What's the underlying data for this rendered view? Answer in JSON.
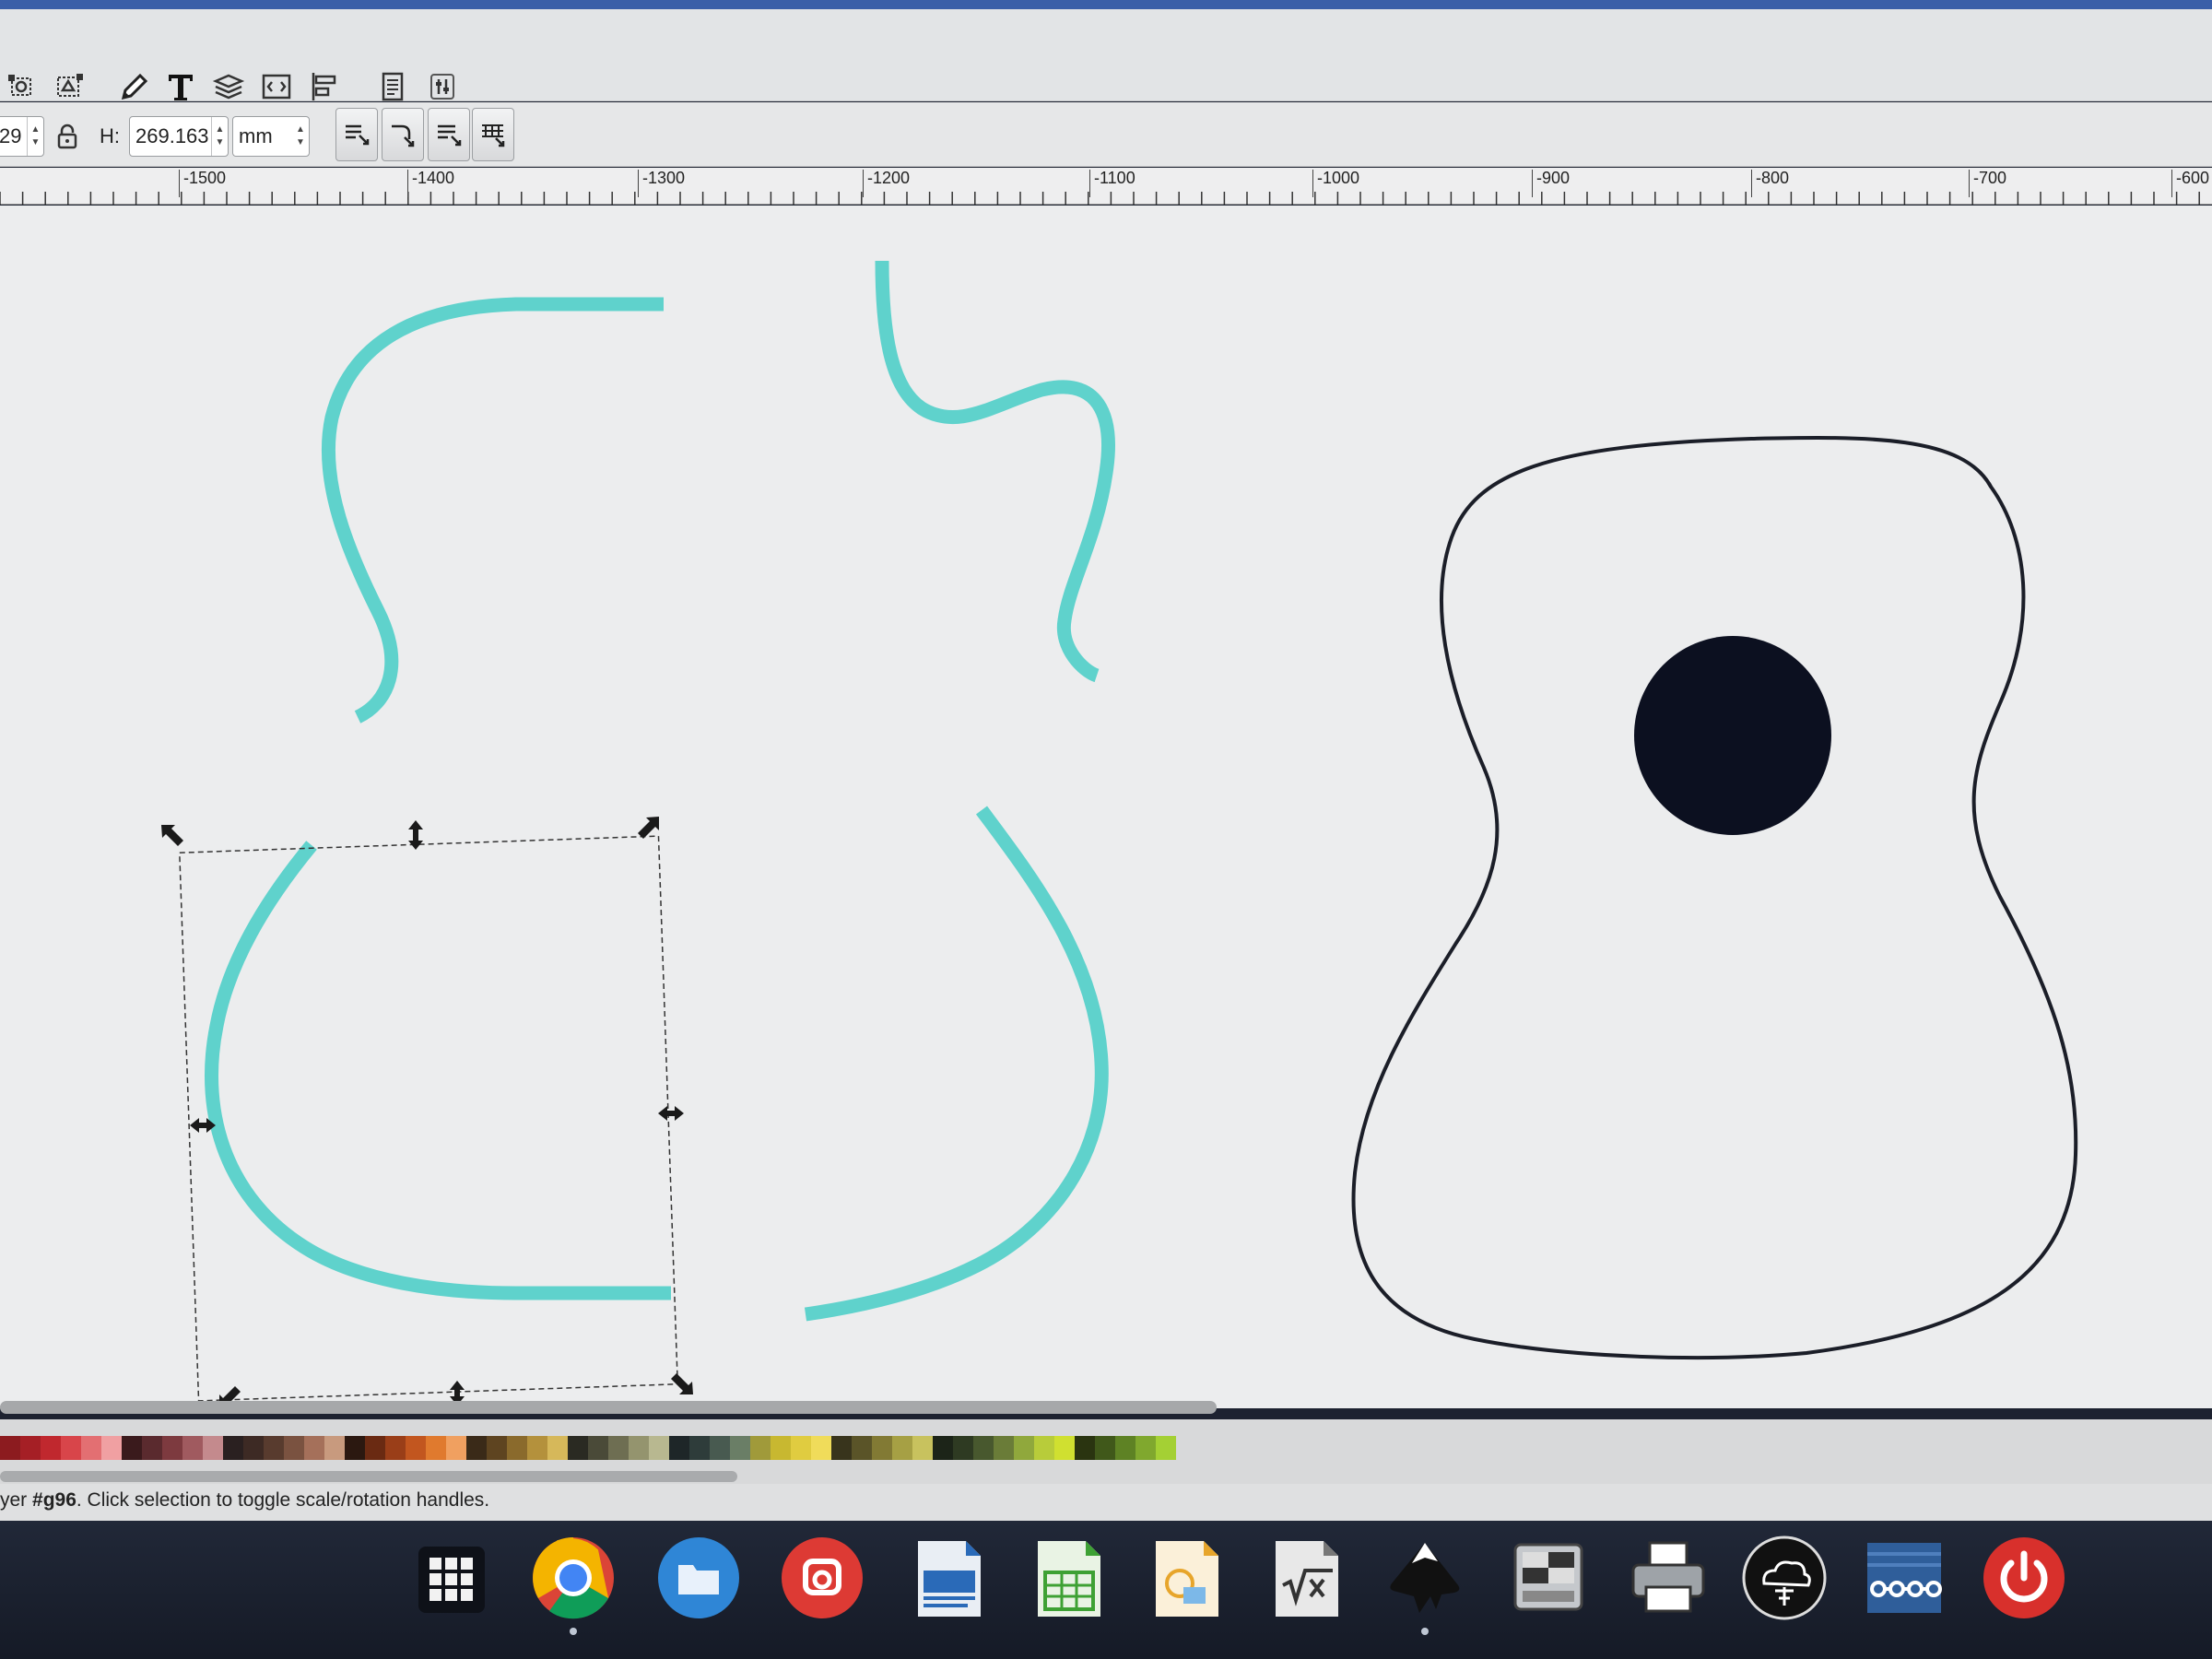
{
  "colors": {
    "accent_stroke": "#5fd2cc",
    "outline_stroke": "#1b1e28",
    "sound_hole": "#0c1020",
    "canvas": "#ecedee",
    "toolbar": "#e2e4e6"
  },
  "commands_bar": {
    "icons": [
      "node-select-icon",
      "transform-node-icon",
      "edit-document-icon",
      "text-tool-icon",
      "layers-icon",
      "xml-editor-icon",
      "align-distribute-icon",
      "document-properties-icon",
      "preferences-icon"
    ]
  },
  "tool_controls": {
    "w_value": "29",
    "lock_icon": "lock-icon",
    "h_label": "H:",
    "h_value": "269.163",
    "unit": "mm",
    "transform_toggles": [
      "scale-stroke-icon",
      "scale-corners-icon",
      "move-gradients-icon",
      "move-patterns-icon"
    ]
  },
  "ruler": {
    "labels": [
      "-1500",
      "-1400",
      "-1300",
      "-1200",
      "-1100",
      "-1000",
      "-900",
      "-800",
      "-700",
      "-600"
    ]
  },
  "canvas": {
    "selected_object": "g96",
    "shapes": [
      "cyan-upper-left-bout",
      "cyan-upper-right-bout",
      "cyan-lower-left-bout",
      "cyan-lower-right-bout",
      "guitar-body-outline",
      "sound-hole"
    ]
  },
  "status": {
    "prefix": "yer ",
    "object_id": "#g96",
    "message": ". Click selection to toggle scale/rotation handles."
  },
  "shelf": {
    "apps": [
      "launcher-icon",
      "chrome-icon",
      "files-icon",
      "red-app-icon",
      "writer-icon",
      "calc-icon",
      "draw-icon",
      "math-icon",
      "inkscape-icon",
      "display-settings-icon",
      "printer-icon",
      "cloud-app-icon",
      "network-app-icon",
      "power-icon"
    ]
  }
}
